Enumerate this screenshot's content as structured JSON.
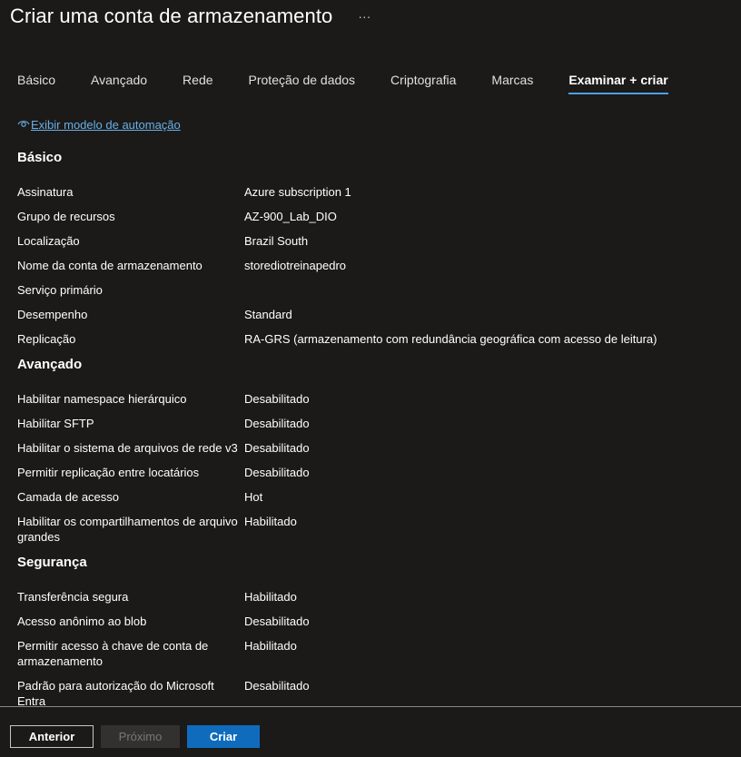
{
  "header": {
    "title": "Criar uma conta de armazenamento",
    "more_icon": "ellipsis-icon"
  },
  "tabs": [
    {
      "label": "Básico"
    },
    {
      "label": "Avançado"
    },
    {
      "label": "Rede"
    },
    {
      "label": "Proteção de dados"
    },
    {
      "label": "Criptografia"
    },
    {
      "label": "Marcas"
    },
    {
      "label": "Examinar + criar",
      "active": true
    }
  ],
  "automation_link": {
    "label": "Exibir modelo de automação",
    "icon": "eye-icon"
  },
  "sections": {
    "basico": {
      "title": "Básico",
      "rows": [
        {
          "label": "Assinatura",
          "value": "Azure subscription 1"
        },
        {
          "label": "Grupo de recursos",
          "value": "AZ-900_Lab_DIO"
        },
        {
          "label": "Localização",
          "value": "Brazil South"
        },
        {
          "label": "Nome da conta de armazenamento",
          "value": "storediotreinapedro"
        },
        {
          "label": "Serviço primário",
          "value": ""
        },
        {
          "label": "Desempenho",
          "value": "Standard"
        },
        {
          "label": "Replicação",
          "value": "RA-GRS (armazenamento com redundância geográfica com acesso de leitura)"
        }
      ]
    },
    "avancado": {
      "title": "Avançado",
      "rows": [
        {
          "label": "Habilitar namespace hierárquico",
          "value": "Desabilitado"
        },
        {
          "label": "Habilitar SFTP",
          "value": "Desabilitado"
        },
        {
          "label": "Habilitar o sistema de arquivos de rede v3",
          "value": "Desabilitado"
        },
        {
          "label": "Permitir replicação entre locatários",
          "value": "Desabilitado"
        },
        {
          "label": "Camada de acesso",
          "value": "Hot"
        },
        {
          "label": "Habilitar os compartilhamentos de arquivo grandes",
          "value": "Habilitado"
        }
      ]
    },
    "seguranca": {
      "title": "Segurança",
      "rows": [
        {
          "label": "Transferência segura",
          "value": "Habilitado"
        },
        {
          "label": "Acesso anônimo ao blob",
          "value": "Desabilitado"
        },
        {
          "label": "Permitir acesso à chave de conta de armazenamento",
          "value": "Habilitado"
        },
        {
          "label": "Padrão para autorização do Microsoft Entra",
          "value": "Desabilitado"
        }
      ]
    }
  },
  "footer": {
    "prev_label": "Anterior",
    "next_label": "Próximo",
    "create_label": "Criar"
  },
  "colors": {
    "background": "#1b1a19",
    "accent": "#0f6cbd",
    "link": "#69afe5",
    "tab_underline": "#4f9ee3"
  }
}
